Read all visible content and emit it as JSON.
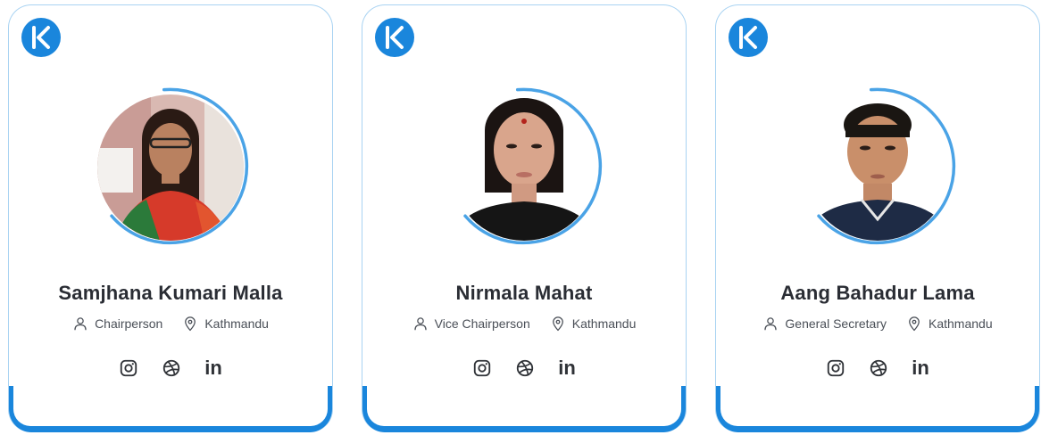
{
  "colors": {
    "accent": "#1a86dc",
    "card_border": "#a9d3f2",
    "ring": "#4aa3e6",
    "text": "#2a2d34",
    "muted": "#4a4f57"
  },
  "cards": [
    {
      "name": "Samjhana Kumari Malla",
      "role": "Chairperson",
      "location": "Kathmandu",
      "role_icon": "user-icon",
      "location_icon": "map-pin-icon",
      "socials": [
        "instagram-icon",
        "dribbble-icon",
        "linkedin-icon"
      ],
      "linkedin_text": "in"
    },
    {
      "name": "Nirmala Mahat",
      "role": "Vice Chairperson",
      "location": "Kathmandu",
      "role_icon": "user-icon",
      "location_icon": "map-pin-icon",
      "socials": [
        "instagram-icon",
        "dribbble-icon",
        "linkedin-icon"
      ],
      "linkedin_text": "in"
    },
    {
      "name": "Aang Bahadur Lama",
      "role": "General Secretary",
      "location": "Kathmandu",
      "role_icon": "user-icon",
      "location_icon": "map-pin-icon",
      "socials": [
        "instagram-icon",
        "dribbble-icon",
        "linkedin-icon"
      ],
      "linkedin_text": "in"
    }
  ]
}
